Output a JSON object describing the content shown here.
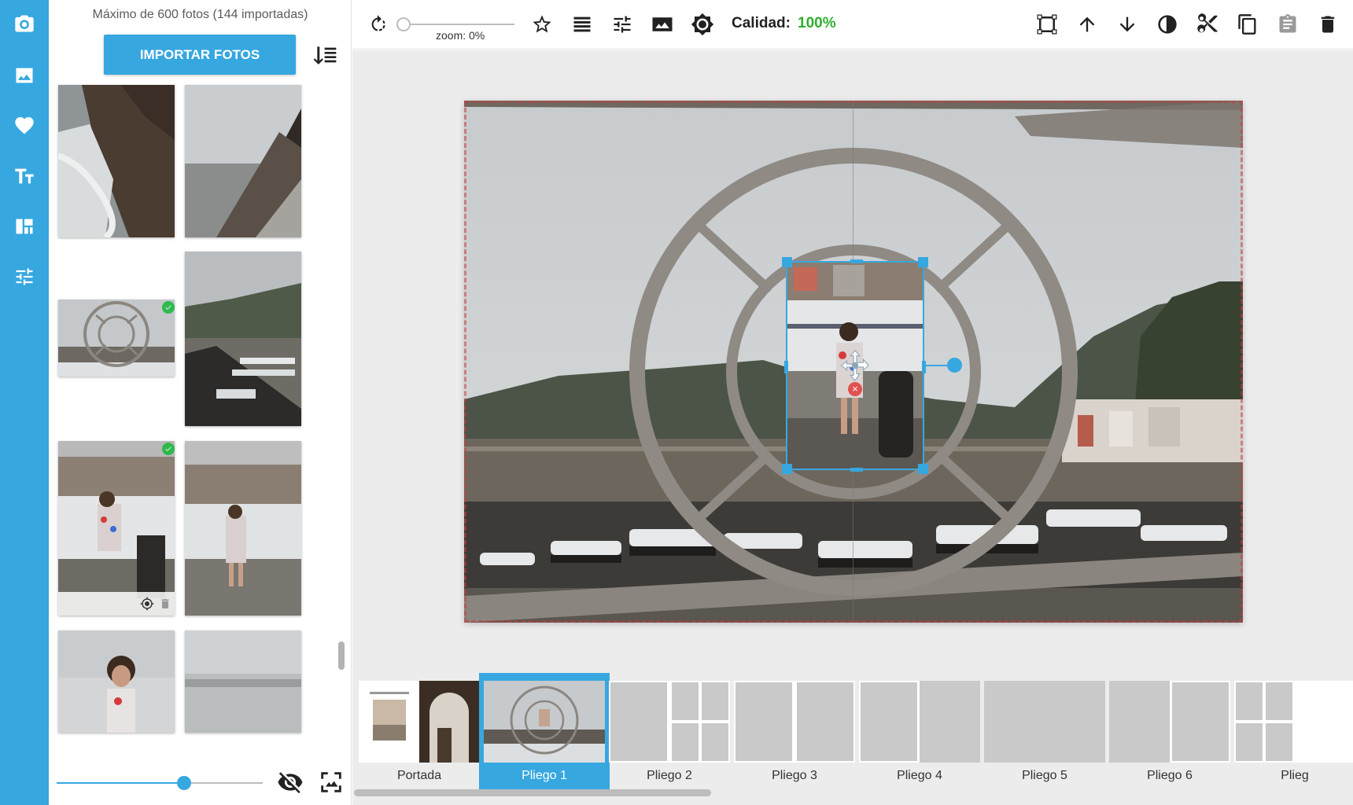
{
  "rail": {
    "items": [
      "camera-icon",
      "image-icon",
      "heart-icon",
      "text-icon",
      "layout-icon",
      "adjust-icon"
    ]
  },
  "panel": {
    "max_text": "Máximo de 600 fotos (144 importadas)",
    "import_label": "IMPORTAR FOTOS",
    "thumb_size_fraction": 0.62
  },
  "toolbar": {
    "zoom_label": "zoom: 0%",
    "zoom_fraction": 0,
    "quality_label": "Calidad:",
    "quality_value": "100%"
  },
  "filmstrip": {
    "pages": [
      {
        "label": "Portada",
        "active": false
      },
      {
        "label": "Pliego 1",
        "active": true
      },
      {
        "label": "Pliego 2",
        "active": false
      },
      {
        "label": "Pliego 3",
        "active": false
      },
      {
        "label": "Pliego 4",
        "active": false
      },
      {
        "label": "Pliego 5",
        "active": false
      },
      {
        "label": "Pliego 6",
        "active": false
      },
      {
        "label": "Plieg",
        "active": false
      }
    ]
  },
  "colors": {
    "accent": "#37a7e0",
    "quality": "#2eae2e",
    "check": "#2eb94e"
  }
}
